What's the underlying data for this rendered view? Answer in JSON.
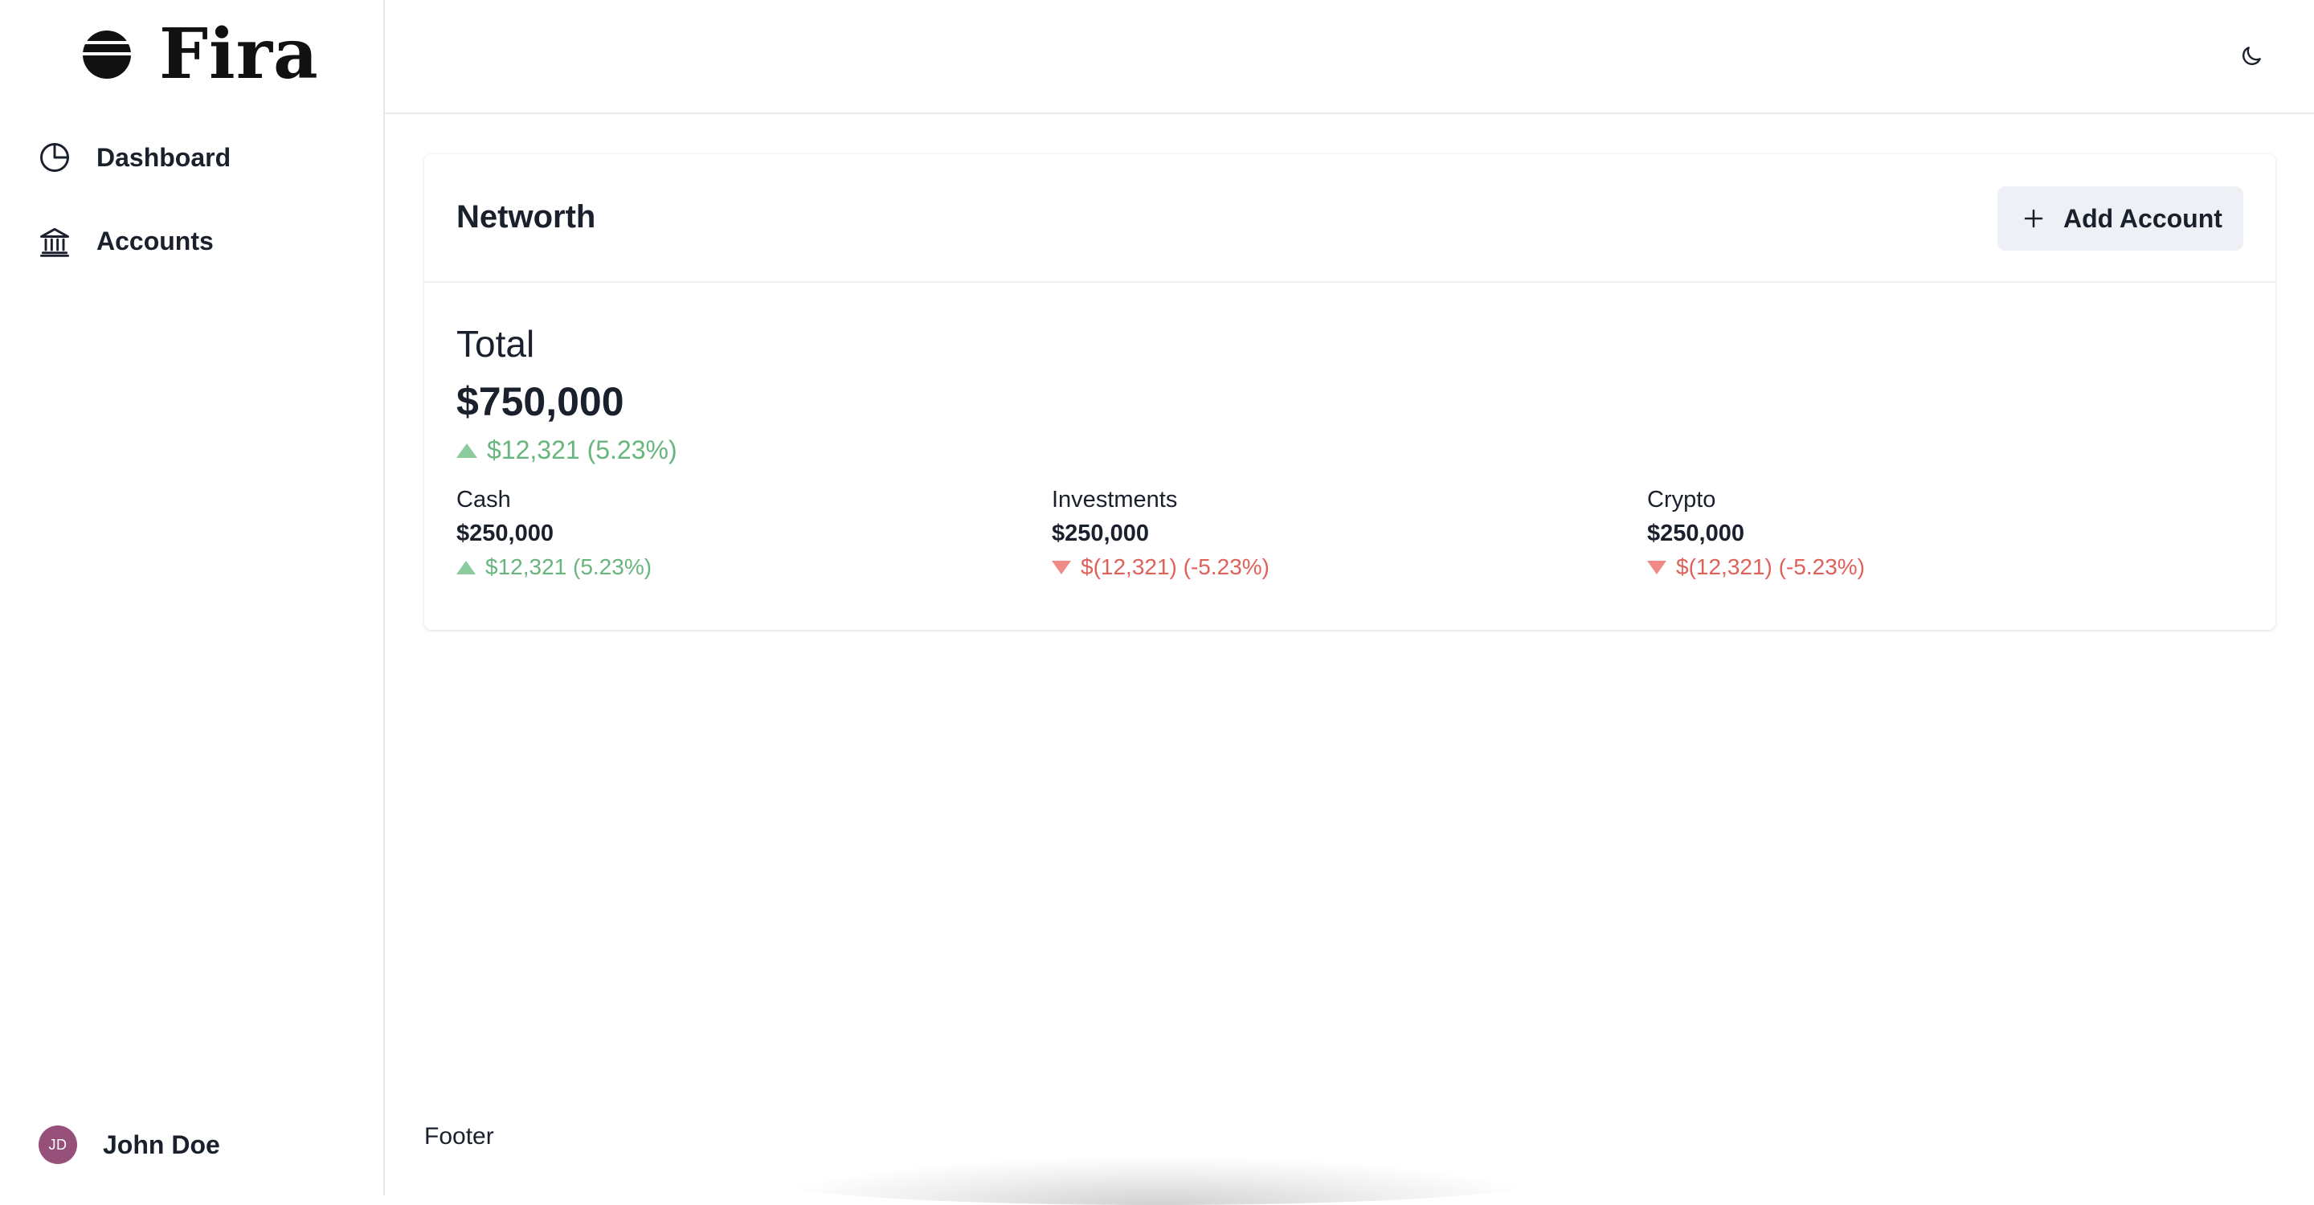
{
  "app": {
    "name": "Fira"
  },
  "sidebar": {
    "items": [
      {
        "label": "Dashboard",
        "icon": "pie-chart-icon"
      },
      {
        "label": "Accounts",
        "icon": "bank-icon"
      }
    ],
    "user": {
      "initials": "JD",
      "name": "John Doe",
      "avatar_color": "#97507a"
    }
  },
  "header": {
    "theme_toggle_icon": "moon-icon"
  },
  "networth": {
    "title": "Networth",
    "add_button_label": "Add Account",
    "total": {
      "label": "Total",
      "amount": "$750,000",
      "change": "$12,321 (5.23%)",
      "direction": "up"
    },
    "accounts": [
      {
        "label": "Cash",
        "amount": "$250,000",
        "change": "$12,321 (5.23%)",
        "direction": "up"
      },
      {
        "label": "Investments",
        "amount": "$250,000",
        "change": "$(12,321) (-5.23%)",
        "direction": "down"
      },
      {
        "label": "Crypto",
        "amount": "$250,000",
        "change": "$(12,321) (-5.23%)",
        "direction": "down"
      }
    ]
  },
  "footer": {
    "text": "Footer"
  },
  "colors": {
    "positive": "#68b57d",
    "negative": "#e0605a",
    "button_bg": "#edf0f4"
  }
}
